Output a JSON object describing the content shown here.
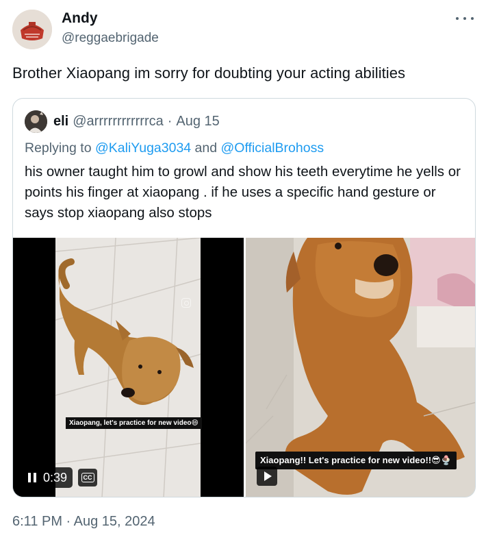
{
  "author": {
    "name": "Andy",
    "handle": "@reggaebrigade",
    "avatar_icon": "red-drum-avatar"
  },
  "tweet": {
    "text": "Brother Xiaopang im sorry for doubting your acting abilities",
    "timestamp": "6:11 PM · Aug 15, 2024"
  },
  "quote": {
    "name": "eli",
    "handle": "@arrrrrrrrrrrrca",
    "separator": "·",
    "date": "Aug 15",
    "reply_prefix": "Replying to ",
    "mention_1": "@KaliYuga3034",
    "reply_join": " and ",
    "mention_2": "@OfficialBrohoss",
    "text": "his owner taught him to growl and show his teeth everytime he yells or points his finger at xiaopang . if he uses a specific hand gesture or says stop xiaopang also stops"
  },
  "media": {
    "video1": {
      "caption": "Xiaopang, let's practice for new video😄",
      "time": "0:39",
      "cc_label": "CC"
    },
    "video2": {
      "caption": "Xiaopang!! Let's practice for new video!!😎🍨"
    }
  },
  "colors": {
    "text": "#0f1419",
    "secondary": "#536471",
    "link": "#1d9bf0",
    "border": "#cfd9de"
  }
}
